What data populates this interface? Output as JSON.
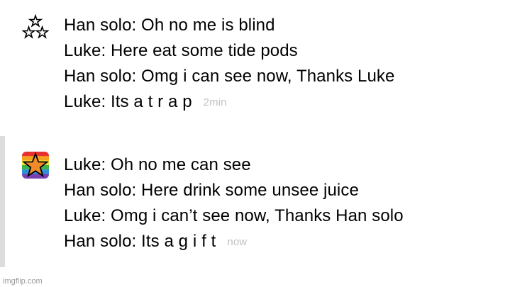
{
  "messages": [
    {
      "avatar_icon": "three-stars-icon",
      "has_left_bar": false,
      "lines": [
        "Han solo: Oh no me is blind",
        "Luke: Here eat some tide pods",
        "Han solo: Omg i can see now, Thanks Luke",
        "Luke: Its a t r a p"
      ],
      "time": "2min"
    },
    {
      "avatar_icon": "rainbow-star-icon",
      "has_left_bar": true,
      "lines": [
        "Luke: Oh no me can see",
        "Han solo: Here drink some unsee juice",
        "Luke: Omg i can’t see now, Thanks Han solo",
        "Han solo: Its a g i f t"
      ],
      "time": "now"
    }
  ],
  "watermark": "imgflip.com",
  "colors": {
    "timestamp": "#c2c2c2",
    "left_bar": "#dcdcdc",
    "rainbow": [
      "#e8312f",
      "#f4a11d",
      "#f2e533",
      "#3fb34a",
      "#2f8fd8",
      "#7a3fb0"
    ],
    "star_fill": "#f08a2a"
  }
}
